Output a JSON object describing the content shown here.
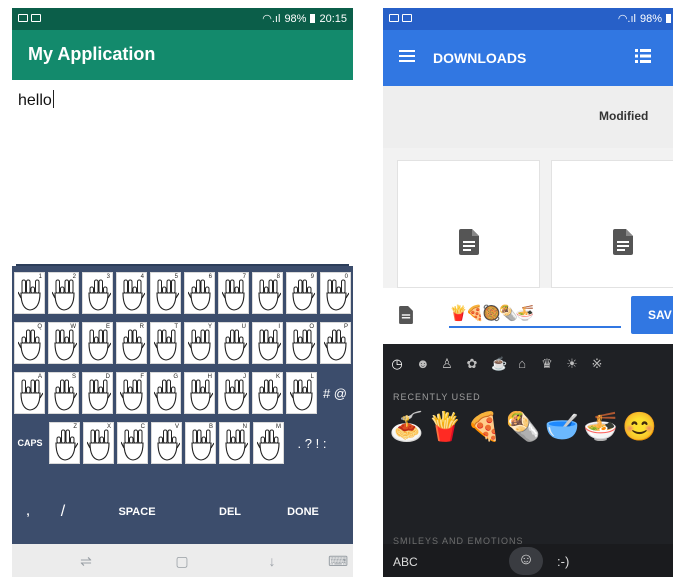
{
  "left_phone": {
    "status_bar": {
      "battery": "98%",
      "time": "20:15"
    },
    "app_title": "My Application",
    "input_text": "hello",
    "keyboard": {
      "row1_labels": [
        "1",
        "2",
        "3",
        "4",
        "5",
        "6",
        "7",
        "8",
        "9",
        "0"
      ],
      "row2_labels": [
        "Q",
        "W",
        "E",
        "R",
        "T",
        "Y",
        "U",
        "I",
        "O",
        "P"
      ],
      "row3_labels": [
        "A",
        "S",
        "D",
        "F",
        "G",
        "H",
        "J",
        "K",
        "L"
      ],
      "row3_extra": "# @",
      "row4_caps": "CAPS",
      "row4_labels": [
        "Z",
        "X",
        "C",
        "V",
        "B",
        "N",
        "M"
      ],
      "row4_extra": ". ? ! :",
      "row5": {
        "comma": ",",
        "slash": "/",
        "space": "SPACE",
        "del": "DEL",
        "done": "DONE"
      }
    },
    "nav_icons": [
      "recent-apps-icon",
      "home-icon",
      "back-icon",
      "keyboard-switch-icon"
    ]
  },
  "right_phone": {
    "status_bar": {
      "battery": "98%"
    },
    "app_title": "DOWNLOADS",
    "sort_label": "Modified",
    "compose": {
      "value": "🍟🍕🥘🌯🍜",
      "send_label": "SAV"
    },
    "emoji_tabs": [
      "clock",
      "smiley",
      "person",
      "paw",
      "food",
      "building",
      "trophy",
      "bulb",
      "symbols"
    ],
    "recently_used_label": "RECENTLY USED",
    "recent_emojis": [
      "🍝",
      "🍟",
      "🍕",
      "🌯",
      "🥣",
      "🍜",
      "😊"
    ],
    "section_label": "SMILEYS AND EMOTIONS",
    "bottom": {
      "abc": "ABC",
      "emoticon": ":-)"
    },
    "colors": {
      "primary": "#3177e2",
      "status": "#2760c8"
    }
  },
  "left_colors": {
    "primary": "#138a6c",
    "status": "#0b5e49",
    "keyboard": "#3c4d6c"
  }
}
